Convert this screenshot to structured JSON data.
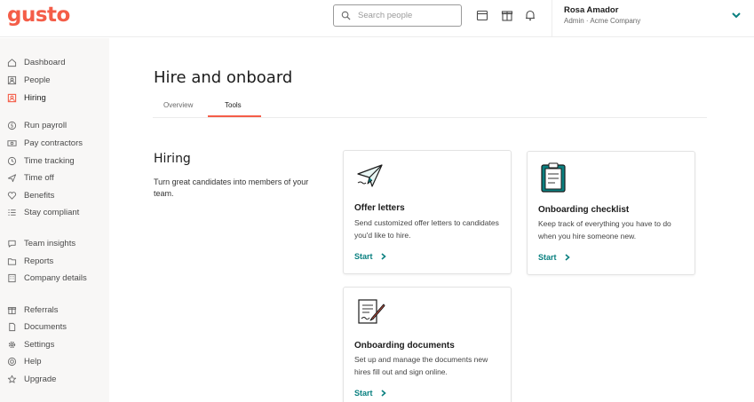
{
  "app": {
    "logo": "gusto"
  },
  "header": {
    "search_placeholder": "Search people",
    "user_name": "Rosa Amador",
    "user_role": "Admin · Acme Company"
  },
  "sidebar": {
    "items": [
      {
        "label": "Dashboard",
        "icon": "home-icon"
      },
      {
        "label": "People",
        "icon": "people-icon"
      },
      {
        "label": "Hiring",
        "icon": "hiring-icon"
      },
      {
        "label": "Run payroll",
        "icon": "dollar-icon"
      },
      {
        "label": "Pay contractors",
        "icon": "money-icon"
      },
      {
        "label": "Time tracking",
        "icon": "clock-icon"
      },
      {
        "label": "Time off",
        "icon": "plane-icon"
      },
      {
        "label": "Benefits",
        "icon": "heart-icon"
      },
      {
        "label": "Stay compliant",
        "icon": "list-icon"
      },
      {
        "label": "Team insights",
        "icon": "chat-icon"
      },
      {
        "label": "Reports",
        "icon": "folder-icon"
      },
      {
        "label": "Company details",
        "icon": "building-icon"
      },
      {
        "label": "Referrals",
        "icon": "gift-icon"
      },
      {
        "label": "Documents",
        "icon": "document-icon"
      },
      {
        "label": "Settings",
        "icon": "gear-icon"
      },
      {
        "label": "Help",
        "icon": "help-icon"
      },
      {
        "label": "Upgrade",
        "icon": "star-icon"
      }
    ],
    "active": "Hiring",
    "accent_color": "#f45d48"
  },
  "main": {
    "title": "Hire and onboard",
    "tabs": [
      {
        "label": "Overview"
      },
      {
        "label": "Tools"
      }
    ],
    "active_tab": "Tools",
    "section": {
      "title": "Hiring",
      "description": "Turn great candidates into members of your team."
    },
    "cards": [
      {
        "title": "Offer letters",
        "description": "Send customized offer letters to candidates you'd like to hire.",
        "action": "Start",
        "icon": "paper-plane-icon"
      },
      {
        "title": "Onboarding checklist",
        "description": "Keep track of everything you have to do when you hire someone new.",
        "action": "Start",
        "icon": "clipboard-icon"
      },
      {
        "title": "Onboarding documents",
        "description": "Set up and manage the documents new hires fill out and sign online.",
        "action": "Start",
        "icon": "signed-document-icon"
      }
    ],
    "link_color": "#0a8080"
  }
}
